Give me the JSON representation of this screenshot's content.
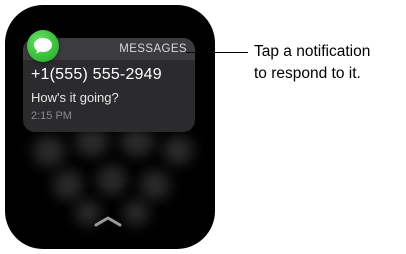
{
  "notification": {
    "app_name": "MESSAGES",
    "sender": "+1(555) 555-2949",
    "body": "How's it going?",
    "time": "2:15 PM",
    "app_icon": "messages-icon"
  },
  "navigation": {
    "dismiss_icon": "chevron-up-icon"
  },
  "callout": {
    "line1": "Tap a notification",
    "line2": "to respond to it."
  },
  "colors": {
    "screen_background": "#000000",
    "card_background": "#2b2b2e",
    "messages_green": "#3cc13c"
  }
}
